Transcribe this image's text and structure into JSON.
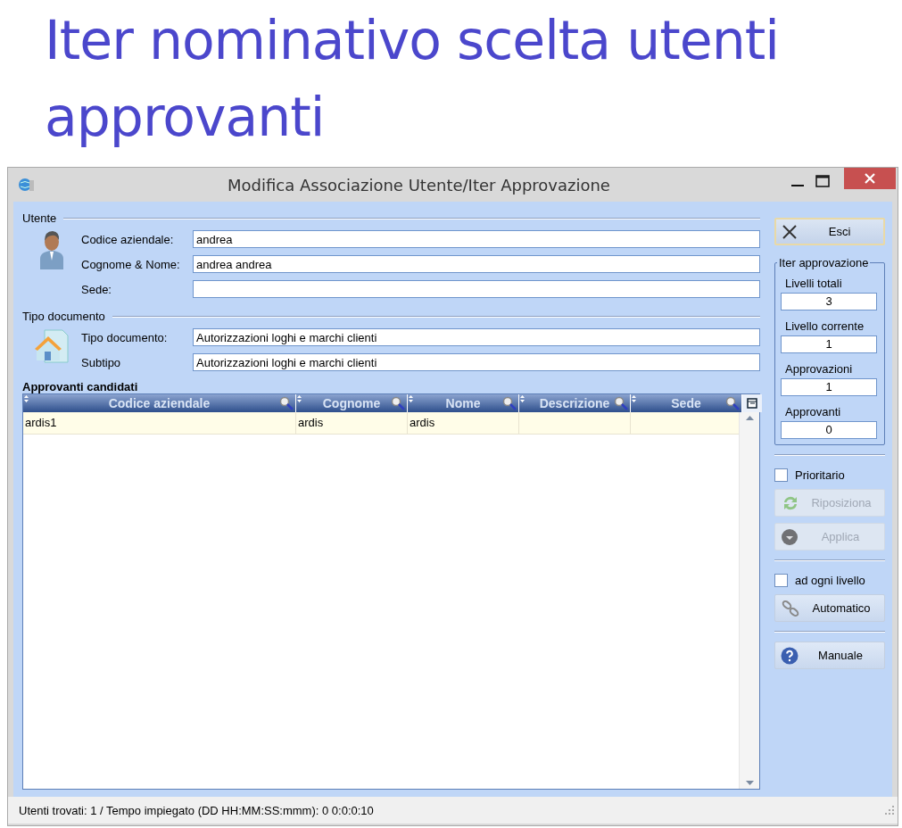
{
  "heading": "Iter nominativo scelta utenti approvanti",
  "window": {
    "title": "Modifica Associazione Utente/Iter Approvazione"
  },
  "utente": {
    "title": "Utente",
    "fields": [
      {
        "label": "Codice aziendale:",
        "value": "andrea"
      },
      {
        "label": "Cognome & Nome:",
        "value": "andrea andrea"
      },
      {
        "label": "Sede:"
      }
    ]
  },
  "tipo_documento": {
    "title": "Tipo documento",
    "fields": [
      {
        "label": "Tipo documento:",
        "value": "Autorizzazioni loghi e marchi clienti"
      },
      {
        "label": "Subtipo",
        "value": "Autorizzazioni loghi e marchi clienti"
      }
    ]
  },
  "grid": {
    "title": "Approvanti candidati",
    "columns": [
      "Codice aziendale",
      "Cognome",
      "Nome",
      "Descrizione",
      "Sede"
    ],
    "rows": [
      [
        "ardis1",
        "ardis",
        "ardis",
        "",
        ""
      ]
    ]
  },
  "side": {
    "exit_button": "Esci",
    "iter": {
      "title": "Iter approvazione",
      "fields": [
        {
          "label": "Livelli totali",
          "value": "3"
        },
        {
          "label": "Livello corrente",
          "value": "1"
        },
        {
          "label": "Approvazioni",
          "value": "1"
        },
        {
          "label": "Approvanti",
          "value": "0"
        }
      ]
    },
    "groups": [
      {
        "checkbox": {
          "label": "Prioritario",
          "checked": false
        },
        "buttons": [
          {
            "label": "Riposiziona",
            "disabled": true
          },
          {
            "label": "Applica",
            "disabled": true
          }
        ]
      },
      {
        "checkbox": {
          "label": "ad ogni livello",
          "checked": false
        },
        "buttons": [
          {
            "label": "Automatico",
            "disabled": false
          }
        ]
      },
      {
        "buttons": [
          {
            "label": "Manuale",
            "disabled": false
          }
        ]
      }
    ]
  },
  "status_bar": "Utenti trovati: 1 / Tempo impiegato (DD HH:MM:SS:mmm):  0 0:0:0:10"
}
